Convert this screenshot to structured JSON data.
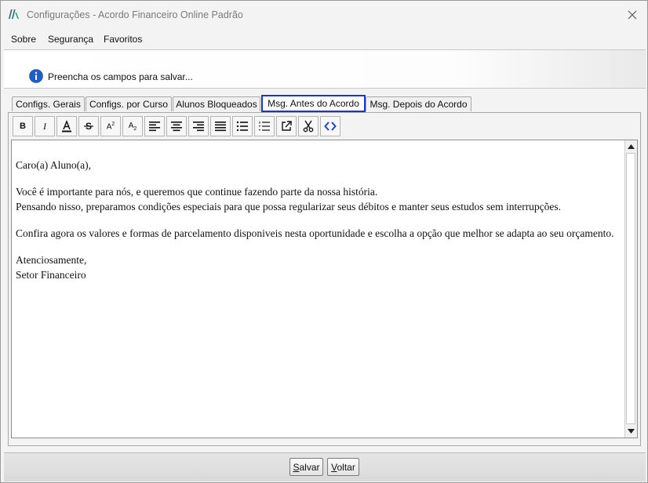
{
  "window": {
    "title": "Configurações - Acordo Financeiro Online Padrão"
  },
  "menu": {
    "items": [
      {
        "label": "Sobre"
      },
      {
        "label": "Segurança"
      },
      {
        "label": "Favoritos"
      }
    ]
  },
  "info": {
    "message": "Preencha os campos para salvar..."
  },
  "tabs": [
    {
      "label": "Configs. Gerais",
      "active": false
    },
    {
      "label": "Configs. por Curso",
      "active": false
    },
    {
      "label": "Alunos Bloqueados",
      "active": false
    },
    {
      "label": "Msg. Antes do Acordo",
      "active": true
    },
    {
      "label": "Msg. Depois do Acordo",
      "active": false
    }
  ],
  "toolbar": {
    "bold": "B",
    "italic": "I",
    "superscript_base": "A",
    "superscript_exp": "2",
    "subscript_base": "A",
    "subscript_exp": "2",
    "icons": [
      "bold-icon",
      "italic-icon",
      "font-color-icon",
      "strikethrough-icon",
      "superscript-icon",
      "subscript-icon",
      "align-left-icon",
      "align-center-icon",
      "align-right-icon",
      "justify-icon",
      "bullet-list-icon",
      "numbered-list-icon",
      "external-link-icon",
      "cut-icon",
      "source-code-icon"
    ]
  },
  "editor": {
    "greeting": "Caro(a) Aluno(a),",
    "p1_line1": "Você é importante para nós, e queremos que continue fazendo parte da nossa história.",
    "p1_line2": "Pensando nisso, preparamos condições especiais para que possa regularizar seus débitos e manter seus estudos sem interrupções.",
    "p2": "Confira agora os valores e formas de parcelamento disponiveis nesta oportunidade e escolha a opção que melhor se adapta ao seu orçamento.",
    "closing": "Atenciosamente,",
    "signature": "Setor Financeiro"
  },
  "footer": {
    "save_underlined": "S",
    "save_rest": "alvar",
    "back_underlined": "V",
    "back_rest": "oltar"
  },
  "colors": {
    "active_tab_border": "#1a36c8",
    "info_icon": "#1f5fc9",
    "logo": "#1d6b6b"
  }
}
